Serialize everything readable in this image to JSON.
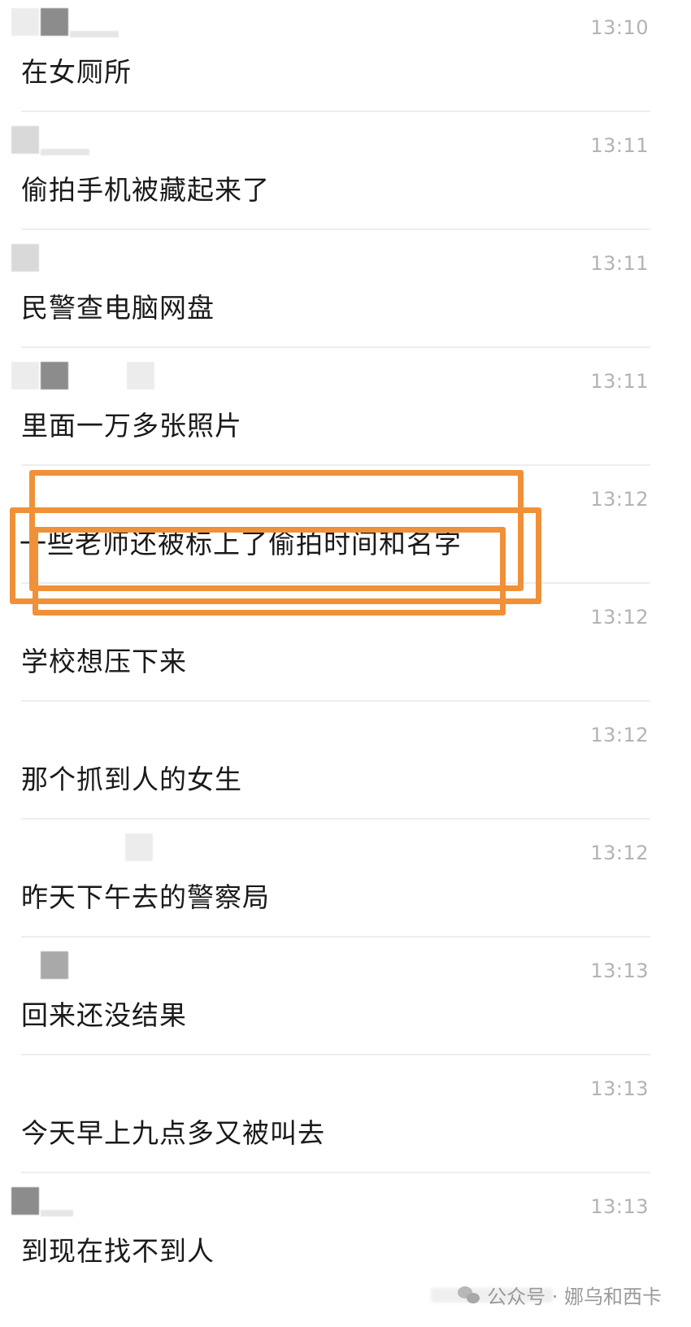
{
  "messages": [
    {
      "time": "13:10",
      "text": "在女厕所"
    },
    {
      "time": "13:11",
      "text": "偷拍手机被藏起来了"
    },
    {
      "time": "13:11",
      "text": "民警查电脑网盘"
    },
    {
      "time": "13:11",
      "text": "里面一万多张照片"
    },
    {
      "time": "13:12",
      "text": "一些老师还被标上了偷拍时间和名字"
    },
    {
      "time": "13:12",
      "text": "学校想压下来"
    },
    {
      "time": "13:12",
      "text": "那个抓到人的女生"
    },
    {
      "time": "13:12",
      "text": "昨天下午去的警察局"
    },
    {
      "time": "13:13",
      "text": "回来还没结果"
    },
    {
      "time": "13:13",
      "text": "今天早上九点多又被叫去"
    },
    {
      "time": "13:13",
      "text": "到现在找不到人"
    }
  ],
  "highlight": {
    "color": "#f0913a",
    "message_index": 4
  },
  "watermark": {
    "icon": "wechat-icon",
    "text": "公众号 · 娜乌和西卡"
  }
}
